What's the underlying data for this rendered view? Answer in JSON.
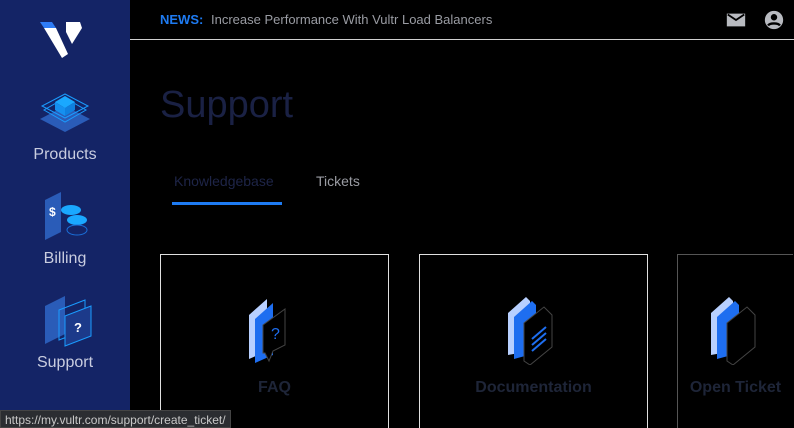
{
  "sidebar": {
    "items": [
      {
        "label": "Products"
      },
      {
        "label": "Billing"
      },
      {
        "label": "Support"
      }
    ]
  },
  "news": {
    "label": "NEWS:",
    "text": "Increase Performance With Vultr Load Balancers"
  },
  "page": {
    "title": "Support"
  },
  "tabs": [
    {
      "label": "Knowledgebase"
    },
    {
      "label": "Tickets"
    }
  ],
  "cards": [
    {
      "label": "FAQ"
    },
    {
      "label": "Documentation"
    },
    {
      "label": "Open Ticket"
    }
  ],
  "status_url": "https://my.vultr.com/support/create_ticket/",
  "colors": {
    "sidebar": "#142466",
    "accent": "#1e7bf2"
  }
}
